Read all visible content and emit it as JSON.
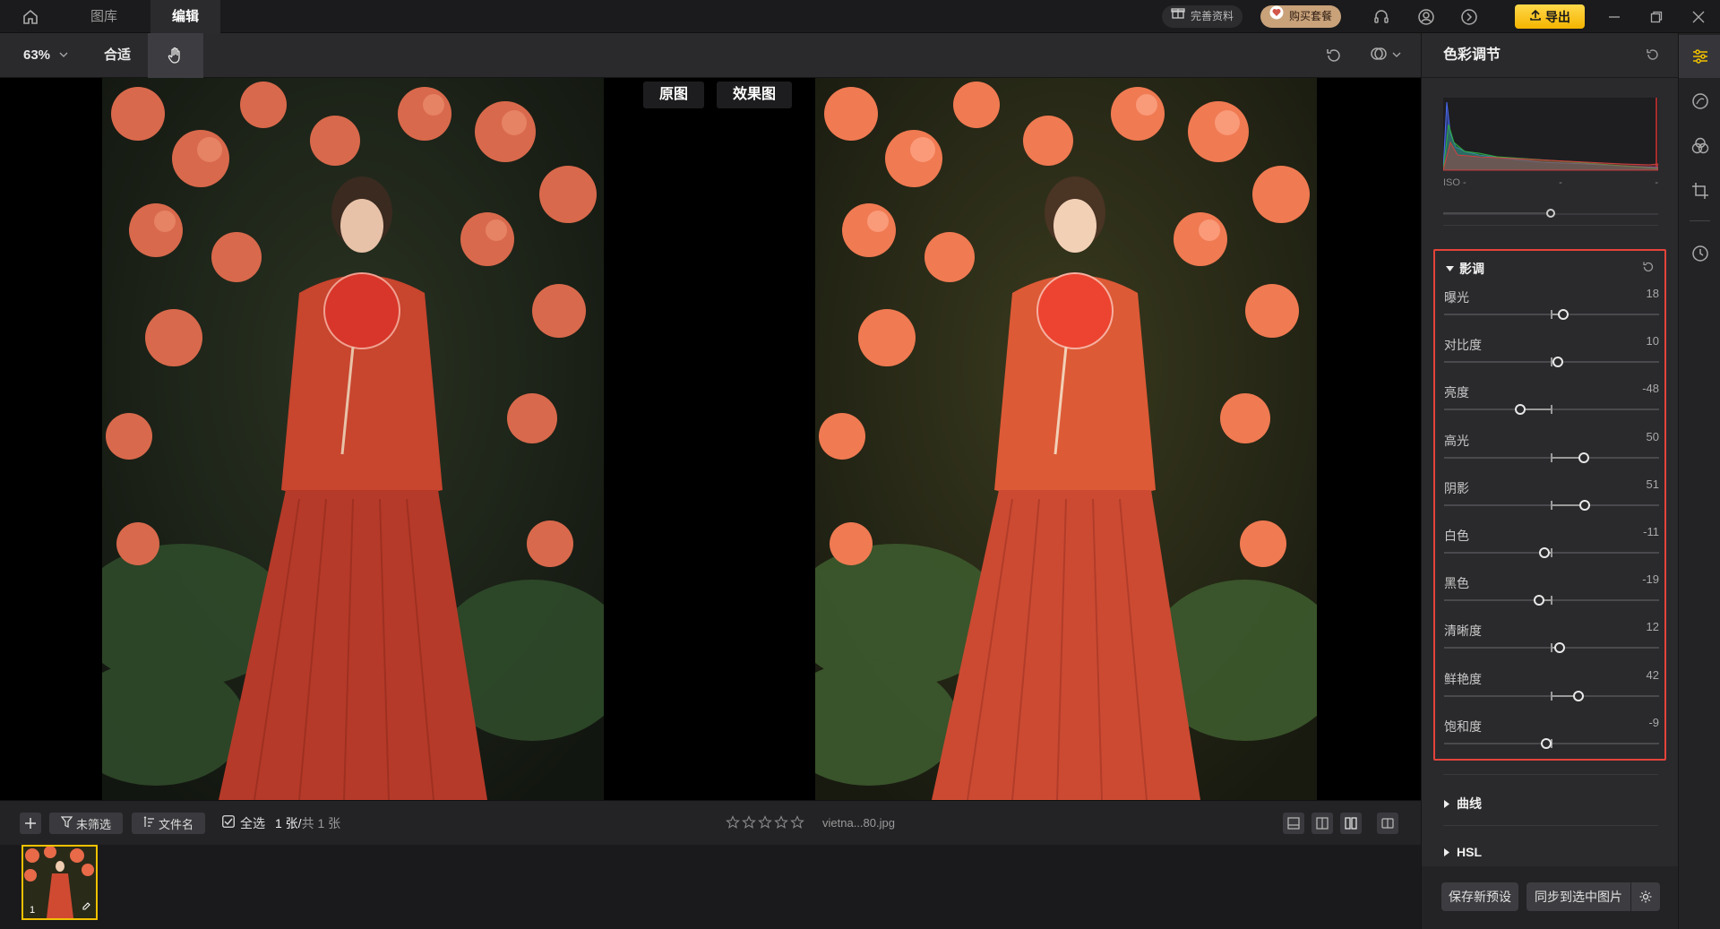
{
  "titlebar": {
    "tabs": [
      {
        "label": "图库",
        "active": false
      },
      {
        "label": "编辑",
        "active": true
      }
    ],
    "profile_pill": "完善资料",
    "buy_pill": "购买套餐",
    "export_label": "导出",
    "accent": "#f5b400"
  },
  "toolbar": {
    "zoom": "63%",
    "fit_label": "合适"
  },
  "canvas": {
    "original_label": "原图",
    "result_label": "效果图"
  },
  "bottombar": {
    "filter_label": "未筛选",
    "sort_label": "文件名",
    "select_all_label": "全选",
    "count_current": "1 张/",
    "count_total": "共 1 张",
    "filename": "vietna...80.jpg",
    "rating": 0,
    "rating_max": 5
  },
  "filmstrip": {
    "thumb_index": "1"
  },
  "panel": {
    "title": "色彩调节",
    "iso_label": "ISO -",
    "iso_mid": "-",
    "iso_right": "-",
    "tone": {
      "title": "影调",
      "highlight_color": "#e4433a",
      "sliders": [
        {
          "label": "曝光",
          "value": "18",
          "level": 18
        },
        {
          "label": "对比度",
          "value": "10",
          "level": 10
        },
        {
          "label": "亮度",
          "value": "-48",
          "level": -48
        },
        {
          "label": "高光",
          "value": "50",
          "level": 50
        },
        {
          "label": "阴影",
          "value": "51",
          "level": 51
        },
        {
          "label": "白色",
          "value": "-11",
          "level": -11
        },
        {
          "label": "黑色",
          "value": "-19",
          "level": -19
        },
        {
          "label": "清晰度",
          "value": "12",
          "level": 12
        },
        {
          "label": "鲜艳度",
          "value": "42",
          "level": 42
        },
        {
          "label": "饱和度",
          "value": "-9",
          "level": -9
        }
      ]
    },
    "curve_label": "曲线",
    "hsl_label": "HSL",
    "save_preset_label": "保存新预设",
    "sync_label": "同步到选中图片"
  }
}
